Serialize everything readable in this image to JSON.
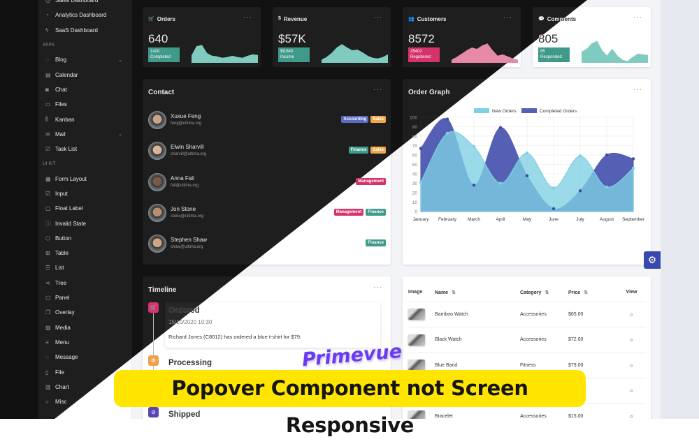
{
  "sidebar": {
    "items": [
      {
        "label": "Sales Dashboard",
        "icon": "◷"
      },
      {
        "label": "Analytics Dashboard",
        "icon": "◔"
      },
      {
        "label": "SaaS Dashboard",
        "icon": "ϟ"
      },
      {
        "label": "APPS",
        "header": true
      },
      {
        "label": "Blog",
        "icon": "◌",
        "chevron": "⌄"
      },
      {
        "label": "Calendar",
        "icon": "▤"
      },
      {
        "label": "Chat",
        "icon": "◙"
      },
      {
        "label": "Files",
        "icon": "▭"
      },
      {
        "label": "Kanban",
        "icon": "⫼"
      },
      {
        "label": "Mail",
        "icon": "✉",
        "chevron": "⌄"
      },
      {
        "label": "Task List",
        "icon": "☑"
      },
      {
        "label": "UI KIT",
        "header": true
      },
      {
        "label": "Form Layout",
        "icon": "▦"
      },
      {
        "label": "Input",
        "icon": "☑"
      },
      {
        "label": "Float Label",
        "icon": "▢"
      },
      {
        "label": "Invalid State",
        "icon": "ⓘ"
      },
      {
        "label": "Button",
        "icon": "⬡"
      },
      {
        "label": "Table",
        "icon": "⊞"
      },
      {
        "label": "List",
        "icon": "☰"
      },
      {
        "label": "Tree",
        "icon": "⋖"
      },
      {
        "label": "Panel",
        "icon": "▢"
      },
      {
        "label": "Overlay",
        "icon": "❐"
      },
      {
        "label": "Media",
        "icon": "▨"
      },
      {
        "label": "Menu",
        "icon": "≡"
      },
      {
        "label": "Message",
        "icon": "◌"
      },
      {
        "label": "File",
        "icon": "▯"
      },
      {
        "label": "Chart",
        "icon": "▥"
      },
      {
        "label": "Misc",
        "icon": "○"
      }
    ]
  },
  "stats": [
    {
      "title": "Orders",
      "icon": "cart-icon",
      "glyph": "🛒",
      "value": "640",
      "badge_value": "1420",
      "badge_label": "Completed",
      "badge_color": "#3f9a8c",
      "spark_color": "#7fcbbf",
      "spark": [
        10,
        24,
        26,
        14,
        10,
        9,
        7,
        8,
        10,
        8,
        7,
        10,
        12,
        11
      ]
    },
    {
      "title": "Revenue",
      "icon": "dollar-icon",
      "glyph": "$",
      "value": "$57K",
      "badge_value": "$9,640",
      "badge_label": "Income",
      "badge_color": "#3f9a8c",
      "spark_color": "#7fcbbf",
      "spark": [
        4,
        8,
        14,
        22,
        27,
        22,
        18,
        19,
        15,
        10,
        7,
        6,
        8,
        12
      ]
    },
    {
      "title": "Customers",
      "icon": "users-icon",
      "glyph": "👥",
      "value": "8572",
      "badge_value": "25402",
      "badge_label": "Registered",
      "badge_color": "#d6336c",
      "spark_color": "#e68aa8",
      "spark": [
        4,
        8,
        13,
        18,
        22,
        20,
        25,
        28,
        18,
        10,
        12,
        9,
        6,
        4
      ]
    },
    {
      "title": "Comments",
      "icon": "comment-icon",
      "glyph": "💬",
      "value": "805",
      "badge_value": "85",
      "badge_label": "Responded",
      "badge_color": "#3f9a8c",
      "spark_color": "#7fcbbf",
      "spark": [
        16,
        20,
        28,
        32,
        18,
        10,
        20,
        10,
        4,
        2,
        8,
        13,
        12,
        11
      ]
    }
  ],
  "more_label": "···",
  "contact": {
    "title": "Contact",
    "people": [
      {
        "name": "Xuxue Feng",
        "email": "feng@ultima.org",
        "tags": [
          {
            "label": "Accounting",
            "color": "#5c6bc0"
          },
          {
            "label": "Sales",
            "color": "#f0a84a"
          }
        ]
      },
      {
        "name": "Elwin Sharvill",
        "email": "sharvill@ultima.org",
        "tags": [
          {
            "label": "Finance",
            "color": "#3f9a8c"
          },
          {
            "label": "Sales",
            "color": "#f0a84a"
          }
        ]
      },
      {
        "name": "Anna Fali",
        "email": "fali@ultima.org",
        "tags": [
          {
            "label": "Management",
            "color": "#d6336c"
          }
        ]
      },
      {
        "name": "Jon Stone",
        "email": "stone@ultima.org",
        "tags": [
          {
            "label": "Management",
            "color": "#d6336c"
          },
          {
            "label": "Finance",
            "color": "#3f9a8c"
          }
        ]
      },
      {
        "name": "Stephen Shaw",
        "email": "shaw@ultima.org",
        "tags": [
          {
            "label": "Finance",
            "color": "#3f9a8c"
          }
        ]
      }
    ]
  },
  "chart_data": {
    "title": "Order Graph",
    "type": "area",
    "categories": [
      "January",
      "February",
      "March",
      "April",
      "May",
      "June",
      "July",
      "August",
      "September"
    ],
    "series": [
      {
        "name": "New Orders",
        "color": "#7fd0e1",
        "values": [
          31,
          83,
          69,
          30,
          62,
          25,
          59,
          26,
          46
        ]
      },
      {
        "name": "Completed Orders",
        "color": "#5560b5",
        "values": [
          67,
          98,
          28,
          89,
          38,
          3,
          22,
          60,
          56
        ]
      }
    ],
    "ylim": [
      0,
      100
    ],
    "yticks": [
      0,
      10,
      20,
      30,
      40,
      50,
      60,
      70,
      80,
      90,
      100
    ],
    "grid": true,
    "legend": "top"
  },
  "timeline": {
    "title": "Timeline",
    "events": [
      {
        "status": "Ordered",
        "date": "15/10/2020 10:30",
        "text": "Richard Jones (C8012) has ordered a blue t-shirt for $79.",
        "color": "#d6336c",
        "glyph": "🛒",
        "icon": "cart-icon"
      },
      {
        "status": "Processing",
        "color": "#f0a04a",
        "glyph": "⚙",
        "icon": "cog-icon"
      },
      {
        "status": "Shipped",
        "color": "#5b45b0",
        "glyph": "⊘",
        "icon": "compass-icon"
      }
    ]
  },
  "products": {
    "columns": [
      "Image",
      "Name",
      "Category",
      "Price",
      "View"
    ],
    "sort_icon": "⇅",
    "rows": [
      {
        "name": "Bamboo Watch",
        "category": "Accessories",
        "price": "$65.00"
      },
      {
        "name": "Black Watch",
        "category": "Accessories",
        "price": "$72.00"
      },
      {
        "name": "Blue Band",
        "category": "Fitness",
        "price": "$79.00"
      },
      {
        "name": "",
        "category": "",
        "price": "…00"
      },
      {
        "name": "Bracelet",
        "category": "Accessories",
        "price": "$15.00"
      }
    ]
  },
  "overlay": {
    "tag": "Primevue",
    "headline": "Popover Component not Screen Responsive"
  },
  "settings_icon": "⚙"
}
